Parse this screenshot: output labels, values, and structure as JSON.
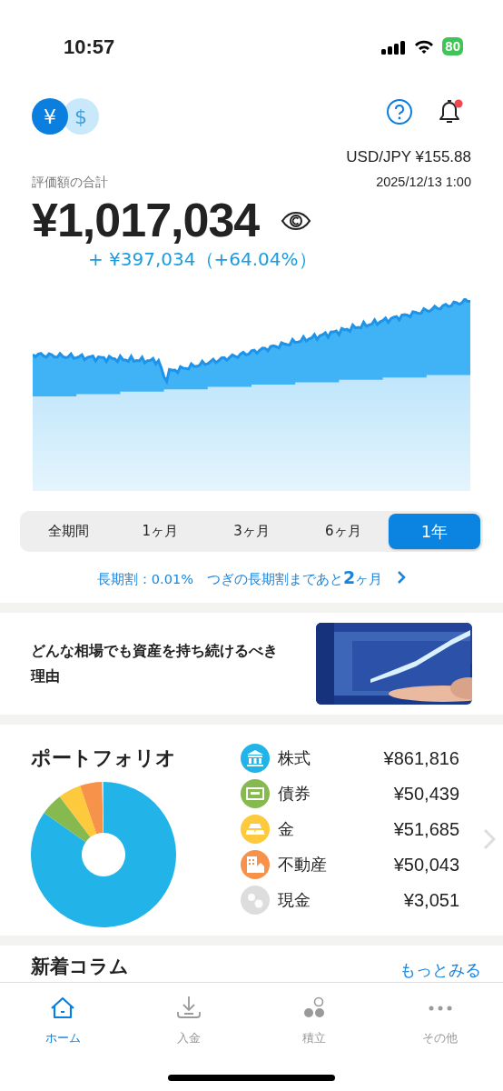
{
  "status_bar": {
    "time": "10:57",
    "battery": "80"
  },
  "header": {
    "currencies": [
      {
        "symbol": "¥",
        "selected": true
      },
      {
        "symbol": "$",
        "selected": false
      }
    ],
    "notification_unread": true,
    "exchange_rate": "USD/JPY  ¥155.88",
    "rate_time": "2025/12/13 1:00"
  },
  "total": {
    "label": "評価額の合計",
    "amount": "¥1,017,034",
    "change": "+ ¥397,034（+64.04%）"
  },
  "periods": [
    {
      "label": "全期間",
      "selected": false
    },
    {
      "label": "1ヶ月",
      "selected": false
    },
    {
      "label": "3ヶ月",
      "selected": false
    },
    {
      "label": "6ヶ月",
      "selected": false
    },
    {
      "label": "1年",
      "selected": true
    }
  ],
  "discount_link": "長期割：0.01%　つぎの長期割まであと**2**ヶ月",
  "article": {
    "title": "どんな相場でも資産を持ち続けるべき理由"
  },
  "portfolio": {
    "title": "ポートフォリオ",
    "assets": [
      {
        "kind": "stock",
        "name": "株式",
        "amount": "¥861,816",
        "color": "#22b4e8"
      },
      {
        "kind": "bond",
        "name": "債券",
        "amount": "¥50,439",
        "color": "#86b94f"
      },
      {
        "kind": "gold_bar",
        "name": "金",
        "amount": "¥51,685",
        "color": "#fdc93d"
      },
      {
        "kind": "real_estate",
        "name": "不動産",
        "amount": "¥50,043",
        "color": "#f7924a"
      },
      {
        "kind": "cash",
        "name": "現金",
        "amount": "¥3,051",
        "color": "#dddddd"
      }
    ]
  },
  "column": {
    "title": "新着コラム",
    "more": "もっとみる"
  },
  "tab_bar": [
    {
      "kind": "home",
      "label": "ホーム",
      "selected": true
    },
    {
      "kind": "deposit",
      "label": "入金",
      "selected": false
    },
    {
      "kind": "saving",
      "label": "積立",
      "selected": false
    },
    {
      "kind": "more",
      "label": "その他",
      "selected": false
    }
  ]
}
